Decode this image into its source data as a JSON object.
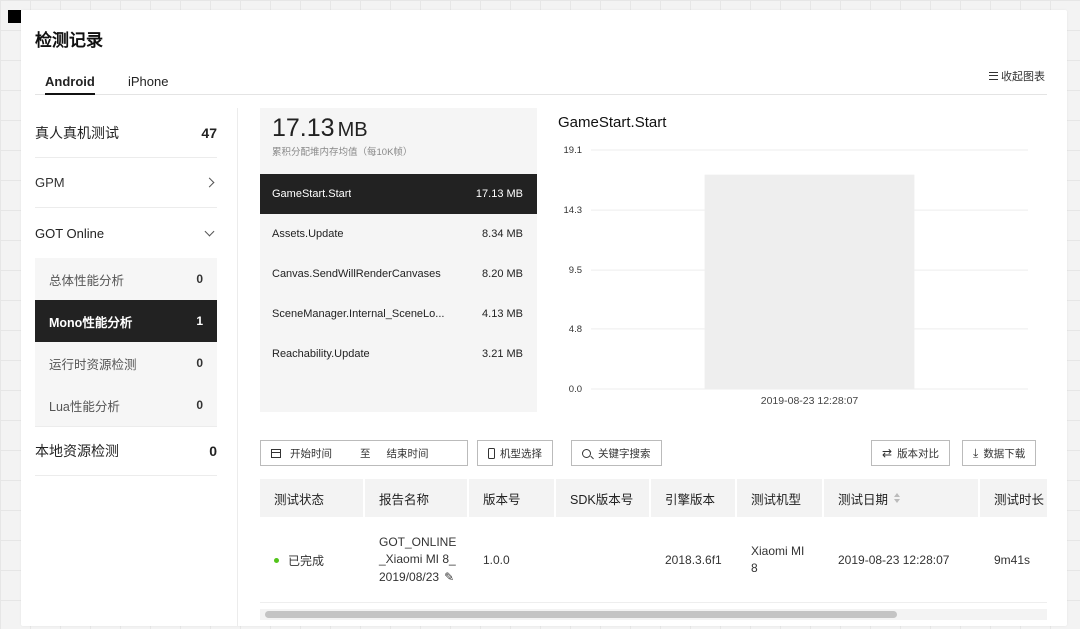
{
  "page": {
    "title": "检测记录"
  },
  "tabs": [
    {
      "label": "Android",
      "active": true
    },
    {
      "label": "iPhone",
      "active": false
    }
  ],
  "toolbar": {
    "collapse_chart_label": "收起图表",
    "collapse_icon": "list-icon"
  },
  "sidebar": {
    "real_device": {
      "label": "真人真机测试",
      "count": "47"
    },
    "gpm": {
      "label": "GPM",
      "icon": "chevron-right-icon"
    },
    "got_online": {
      "label": "GOT Online",
      "icon": "chevron-down-icon",
      "items": [
        {
          "label": "总体性能分析",
          "count": "0",
          "active": false
        },
        {
          "label": "Mono性能分析",
          "count": "1",
          "active": true
        },
        {
          "label": "运行时资源检测",
          "count": "0",
          "active": false
        },
        {
          "label": "Lua性能分析",
          "count": "0",
          "active": false
        }
      ]
    },
    "local_resource": {
      "label": "本地资源检测",
      "count": "0"
    }
  },
  "summary": {
    "value": "17.13",
    "unit": "MB",
    "subtitle": "累积分配堆内存均值（每10K帧）",
    "functions": [
      {
        "name": "GameStart.Start",
        "value": "17.13 MB",
        "active": true
      },
      {
        "name": "Assets.Update",
        "value": "8.34 MB",
        "active": false
      },
      {
        "name": "Canvas.SendWillRenderCanvases",
        "value": "8.20 MB",
        "active": false
      },
      {
        "name": "SceneManager.Internal_SceneLo...",
        "value": "4.13 MB",
        "active": false
      },
      {
        "name": "Reachability.Update",
        "value": "3.21 MB",
        "active": false
      }
    ]
  },
  "chart_data": {
    "type": "bar",
    "title": "GameStart.Start",
    "categories": [
      "2019-08-23 12:28:07"
    ],
    "values": [
      17.13
    ],
    "yticks": [
      "0.0",
      "4.8",
      "9.5",
      "14.3",
      "19.1"
    ],
    "ylim": [
      0,
      19.1
    ],
    "grid": true,
    "bar_color": "#eeeeee",
    "grid_color": "#ededed"
  },
  "filters": {
    "calendar_icon": "calendar-icon",
    "start_placeholder": "开始时间",
    "separator": "至",
    "end_placeholder": "结束时间",
    "model_select": "机型选择",
    "keyword_search": "关键字搜索",
    "version_compare": "版本对比",
    "data_download": "数据下载"
  },
  "table": {
    "columns": [
      "测试状态",
      "报告名称",
      "版本号",
      "SDK版本号",
      "引擎版本",
      "测试机型",
      "测试日期",
      "测试时长"
    ],
    "rows": [
      {
        "status": "已完成",
        "status_color": "#52c41a",
        "report_name": "GOT_ONLINE_Xiaomi MI 8_2019/08/23",
        "version": "1.0.0",
        "sdk_version": "",
        "engine_version": "2018.3.6f1",
        "device": "Xiaomi MI 8",
        "date": "2019-08-23 12:28:07",
        "duration": "9m41s"
      }
    ]
  }
}
